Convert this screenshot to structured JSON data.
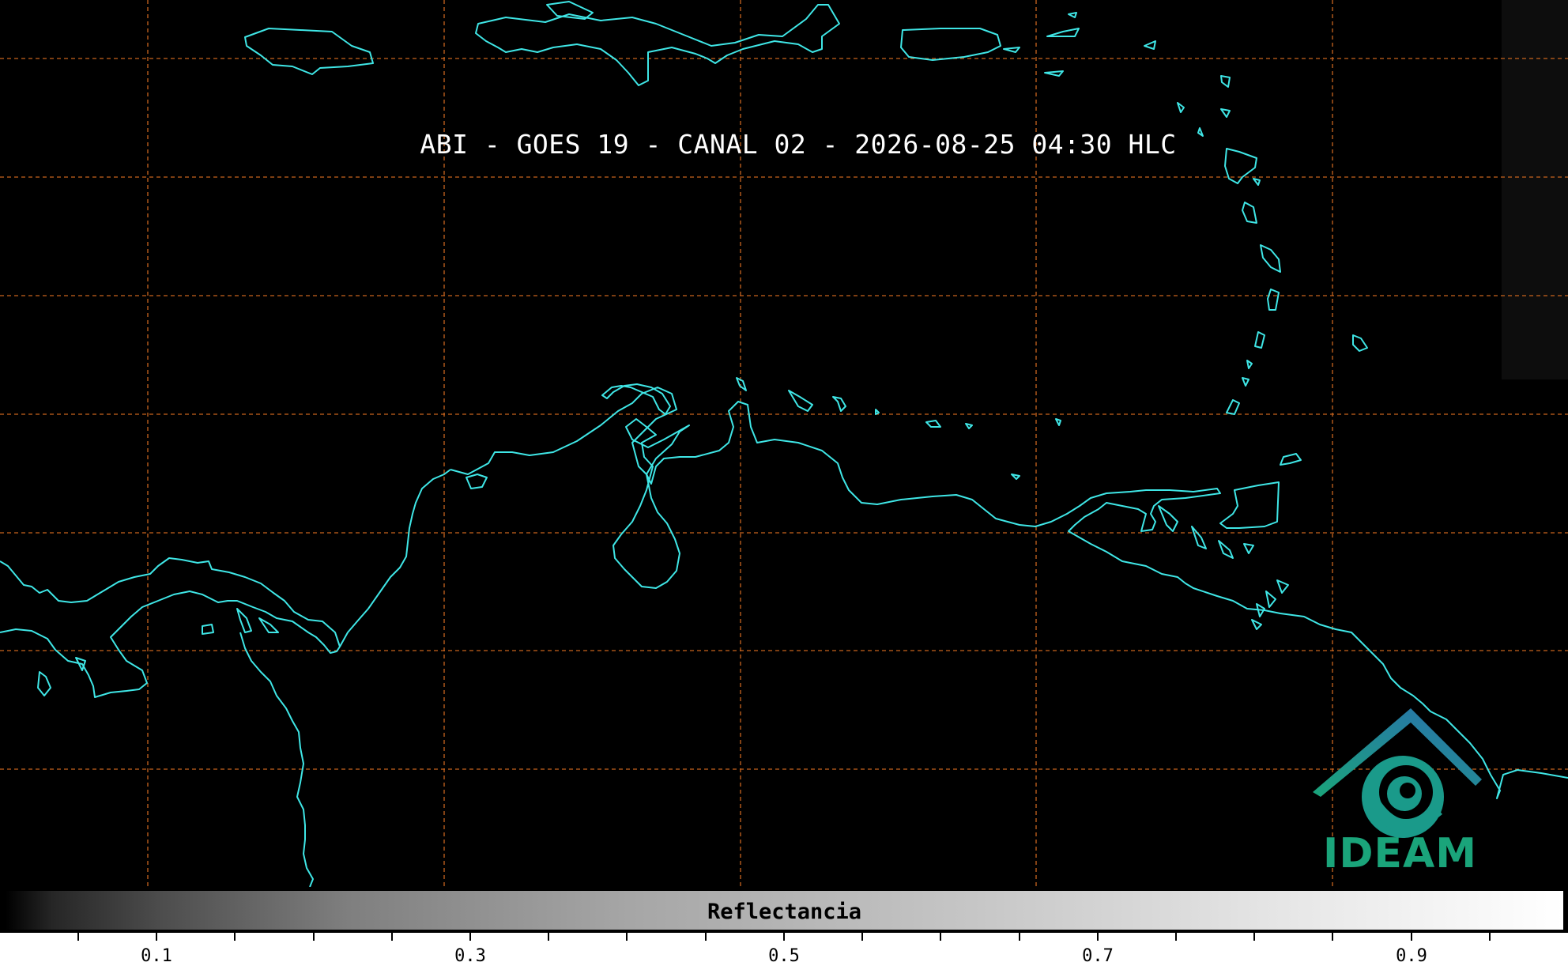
{
  "title": "ABI - GOES 19 - CANAL 02 - 2026-08-25 04:30 HLC",
  "colorbar": {
    "label": "Reflectancia",
    "tick_labels": [
      "0.1",
      "0.3",
      "0.5",
      "0.7",
      "0.9"
    ]
  },
  "logo": {
    "text": "IDEAM",
    "icon": "ideam-logo-icon"
  },
  "colors": {
    "coastline": "#3fe6e6",
    "gridline": "#c8641e",
    "logo_green": "#1aa47a",
    "logo_blue": "#2a6fb0"
  }
}
